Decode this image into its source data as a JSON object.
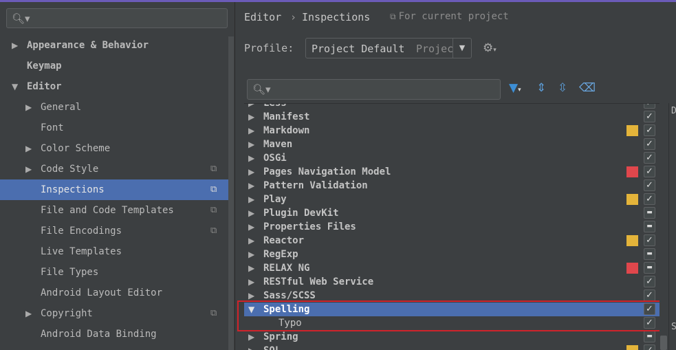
{
  "sidebar": {
    "items": [
      {
        "label": "Appearance & Behavior",
        "arrow": "collapsed",
        "bold": true
      },
      {
        "label": "Keymap",
        "bold": true
      },
      {
        "label": "Editor",
        "arrow": "expanded",
        "bold": true
      },
      {
        "label": "General",
        "arrow": "collapsed"
      },
      {
        "label": "Font"
      },
      {
        "label": "Color Scheme",
        "arrow": "collapsed"
      },
      {
        "label": "Code Style",
        "arrow": "collapsed",
        "project_icon": true
      },
      {
        "label": "Inspections",
        "selected": true,
        "project_icon": true
      },
      {
        "label": "File and Code Templates",
        "project_icon": true
      },
      {
        "label": "File Encodings",
        "project_icon": true
      },
      {
        "label": "Live Templates"
      },
      {
        "label": "File Types"
      },
      {
        "label": "Android Layout Editor"
      },
      {
        "label": "Copyright",
        "arrow": "collapsed",
        "project_icon": true
      },
      {
        "label": "Android Data Binding"
      }
    ]
  },
  "breadcrumb": {
    "editor": "Editor",
    "separator": "›",
    "inspections": "Inspections",
    "scope_note": "For current project"
  },
  "profile": {
    "label": "Profile:",
    "value": "Project Default",
    "hint": "Project"
  },
  "inspections": {
    "rows": [
      {
        "label": "Less",
        "arrow": "collapsed",
        "check": "checked"
      },
      {
        "label": "Manifest",
        "arrow": "collapsed",
        "check": "checked"
      },
      {
        "label": "Markdown",
        "arrow": "collapsed",
        "severity": "#e4b43a",
        "check": "checked"
      },
      {
        "label": "Maven",
        "arrow": "collapsed",
        "check": "checked"
      },
      {
        "label": "OSGi",
        "arrow": "collapsed",
        "check": "checked"
      },
      {
        "label": "Pages Navigation Model",
        "arrow": "collapsed",
        "severity": "#e0474c",
        "check": "checked"
      },
      {
        "label": "Pattern Validation",
        "arrow": "collapsed",
        "check": "checked"
      },
      {
        "label": "Play",
        "arrow": "collapsed",
        "severity": "#e4b43a",
        "check": "checked"
      },
      {
        "label": "Plugin DevKit",
        "arrow": "collapsed",
        "check": "mixed"
      },
      {
        "label": "Properties Files",
        "arrow": "collapsed",
        "check": "mixed"
      },
      {
        "label": "Reactor",
        "arrow": "collapsed",
        "severity": "#e4b43a",
        "check": "checked"
      },
      {
        "label": "RegExp",
        "arrow": "collapsed",
        "check": "mixed"
      },
      {
        "label": "RELAX NG",
        "arrow": "collapsed",
        "severity": "#e0474c",
        "check": "mixed"
      },
      {
        "label": "RESTful Web Service",
        "arrow": "collapsed",
        "check": "checked"
      },
      {
        "label": "Sass/SCSS",
        "arrow": "collapsed",
        "check": "checked"
      },
      {
        "label": "Spelling",
        "arrow": "expanded",
        "selected": true,
        "check": "checked"
      },
      {
        "label": "Typo",
        "child": true,
        "check": "checked"
      },
      {
        "label": "Spring",
        "arrow": "collapsed",
        "check": "mixed"
      },
      {
        "label": "SQL",
        "arrow": "collapsed",
        "severity": "#e4b43a",
        "check": "checked"
      }
    ]
  },
  "right_strip": {
    "top_char": "D",
    "bottom_char": "S"
  },
  "colors": {
    "accent": "#4b6eaf",
    "highlight_box": "#d0232b",
    "warning": "#e4b43a",
    "error": "#e0474c"
  }
}
